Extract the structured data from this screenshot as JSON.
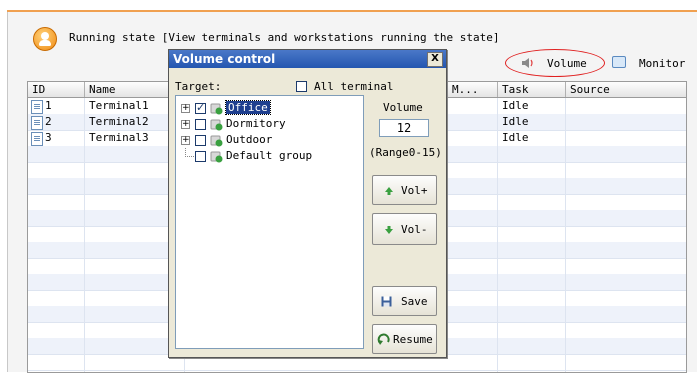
{
  "header": {
    "title": "Running state [View terminals and workstations running the state]",
    "volume_label": "Volume",
    "monitor_label": "Monitor"
  },
  "table": {
    "columns": [
      "ID",
      "Name",
      "",
      "",
      "M...",
      "Task",
      "Source"
    ],
    "rows": [
      {
        "id": "1",
        "name": "Terminal1",
        "task": "Idle",
        "source": ""
      },
      {
        "id": "2",
        "name": "Terminal2",
        "task": "Idle",
        "source": ""
      },
      {
        "id": "3",
        "name": "Terminal3",
        "task": "Idle",
        "source": ""
      }
    ]
  },
  "dialog": {
    "title": "Volume control",
    "close_label": "X",
    "target_label": "Target:",
    "all_terminal_label": "All terminal",
    "all_terminal_checked": false,
    "tree": [
      {
        "label": "Office",
        "checked": true,
        "selected": true,
        "expandable": true
      },
      {
        "label": "Dormitory",
        "checked": false,
        "selected": false,
        "expandable": true
      },
      {
        "label": "Outdoor",
        "checked": false,
        "selected": false,
        "expandable": true
      },
      {
        "label": "Default group",
        "checked": false,
        "selected": false,
        "expandable": false
      }
    ],
    "volume_label": "Volume",
    "volume_value": "12",
    "range_label": "(Range0-15)",
    "vol_up_label": "Vol+",
    "vol_down_label": "Vol-",
    "save_label": "Save",
    "resume_label": "Resume"
  },
  "colors": {
    "accent_orange": "#f0a050",
    "highlight_red": "#e02020",
    "titlebar_blue": "#2456b0",
    "arrow_green": "#3aa040"
  }
}
